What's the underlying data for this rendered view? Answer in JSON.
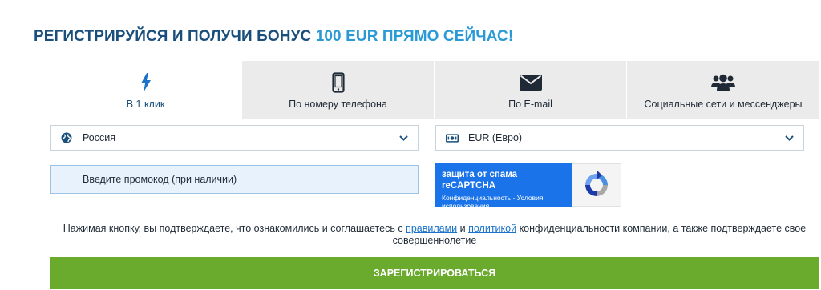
{
  "header": {
    "title_main": "РЕГИСТРИРУЙСЯ И ПОЛУЧИ БОНУС ",
    "title_accent": "100 EUR ПРЯМО СЕЙЧАС!"
  },
  "tabs": [
    {
      "label": "В 1 клик",
      "icon": "lightning-icon",
      "active": true
    },
    {
      "label": "По номеру телефона",
      "icon": "phone-icon",
      "active": false
    },
    {
      "label": "По E-mail",
      "icon": "envelope-icon",
      "active": false
    },
    {
      "label": "Социальные сети и мессенджеры",
      "icon": "users-icon",
      "active": false
    }
  ],
  "form": {
    "country": {
      "value": "Россия",
      "icon": "globe-icon"
    },
    "currency": {
      "value": "EUR (Евро)",
      "icon": "banknote-icon"
    },
    "promo": {
      "placeholder": "Введите промокод (при наличии)"
    }
  },
  "recaptcha": {
    "title": "защита от спама reCAPTCHA",
    "links": "Конфиденциальность - Условия использования",
    "icon": "recaptcha-icon"
  },
  "terms": {
    "part1": "Нажимая кнопку, вы подтверждаете, что ознакомились и соглашаетесь с ",
    "link_rules": "правилами",
    "part2": " и ",
    "link_policy": "политикой",
    "part3": " конфиденциальности компании, а также подтверждаете свое совершеннолетие"
  },
  "submit": {
    "label": "ЗАРЕГИСТРИРОВАТЬСЯ"
  },
  "colors": {
    "accent": "#2a9ad6",
    "title": "#1a4f7c",
    "submit": "#6aaa2c",
    "link": "#1a73c9"
  }
}
